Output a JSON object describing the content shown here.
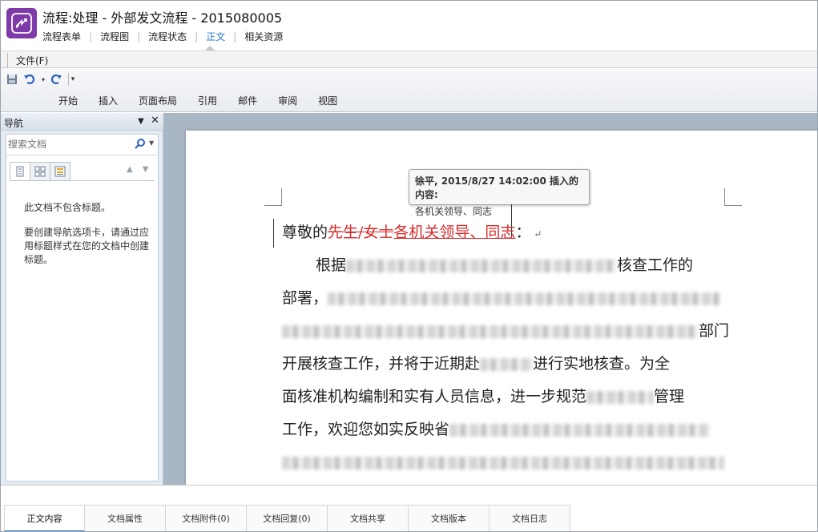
{
  "header": {
    "title": "流程:处理 - 外部发文流程 - 2015080005",
    "tabs": [
      {
        "label": "流程表单"
      },
      {
        "label": "流程图"
      },
      {
        "label": "流程状态"
      },
      {
        "label": "正文",
        "active": true
      },
      {
        "label": "相关资源"
      }
    ],
    "logo_color": "#7e3aa8",
    "active_tab_color": "#2a7fd4"
  },
  "menubar": {
    "file_label": "文件(F)"
  },
  "ribbon": {
    "quick_access": [
      "save-icon",
      "undo-icon",
      "redo-icon",
      "customize-icon"
    ],
    "tabs": [
      "开始",
      "插入",
      "页面布局",
      "引用",
      "邮件",
      "审阅",
      "视图"
    ]
  },
  "nav": {
    "title": "导航",
    "search_placeholder": "搜索文档",
    "empty_message": "此文档不包含标题。",
    "help_message": "要创建导航选项卡，请通过应用标题样式在您的文档中创建标题。"
  },
  "document": {
    "tooltip": {
      "header": "徐平, 2015/8/27 14:02:00 插入的内容:",
      "body": "各机关领导、同志"
    },
    "salutation": {
      "prefix": "尊敬的",
      "deleted": "先生/女士",
      "inserted": "各机关领导、同志",
      "suffix": "："
    },
    "lines": {
      "l1a": "根据",
      "l1b": "核查工作的",
      "l2a": "部署，",
      "l3b": "部门",
      "l4a": "开展核查工作，并将于近期赴",
      "l4b": "进行实地核查。为全",
      "l5a": "面核准机构编制和实有人员信息，进一步规范",
      "l5b": "管理",
      "l6a": "工作，欢迎您如实反映省"
    },
    "revision_color": "#d82a2a"
  },
  "bottom_tabs": [
    {
      "label": "正文内容",
      "active": true
    },
    {
      "label": "文档属性"
    },
    {
      "label": "文档附件(0)"
    },
    {
      "label": "文档回复(0)"
    },
    {
      "label": "文档共享"
    },
    {
      "label": "文档版本"
    },
    {
      "label": "文档日志"
    }
  ]
}
